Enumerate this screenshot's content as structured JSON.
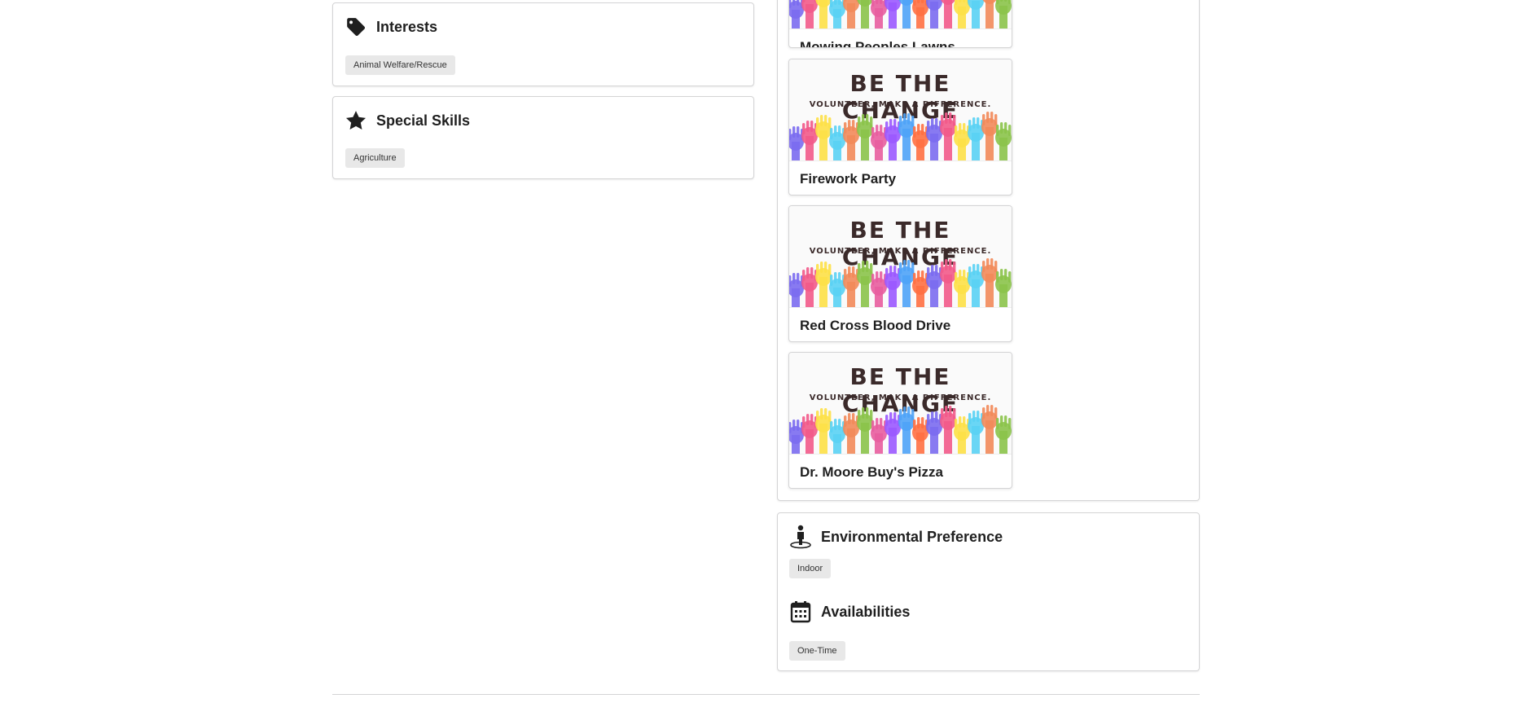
{
  "interests": {
    "title": "Interests",
    "icon": "tag-icon",
    "tags": [
      "Animal Welfare/Rescue"
    ]
  },
  "special_skills": {
    "title": "Special Skills",
    "icon": "star-icon",
    "tags": [
      "Agriculture"
    ]
  },
  "events": [
    {
      "name": "Mowing Peoples Lawns"
    },
    {
      "name": "Firework Party",
      "banner_title": "BE THE CHANGE",
      "banner_subtitle": "VOLUNTEER, MAKE A DIFFERENCE."
    },
    {
      "name": "Red Cross Blood Drive",
      "banner_title": "BE THE CHANGE",
      "banner_subtitle": "VOLUNTEER, MAKE A DIFFERENCE."
    },
    {
      "name": "Dr. Moore Buy's Pizza",
      "banner_title": "BE THE CHANGE",
      "banner_subtitle": "VOLUNTEER, MAKE A DIFFERENCE."
    }
  ],
  "environmental_preference": {
    "title": "Environmental Preference",
    "icon": "person-icon",
    "tags": [
      "Indoor"
    ]
  },
  "availabilities": {
    "title": "Availabilities",
    "icon": "calendar-icon",
    "tags": [
      "One-Time"
    ]
  },
  "colors": {
    "hand_palette": [
      "#7b6cf0",
      "#f25a8a",
      "#fde047",
      "#5ad2f4",
      "#f28a5a",
      "#8bc34a",
      "#e85d9e",
      "#9b59ff",
      "#4fa3f7",
      "#ff7043"
    ]
  }
}
